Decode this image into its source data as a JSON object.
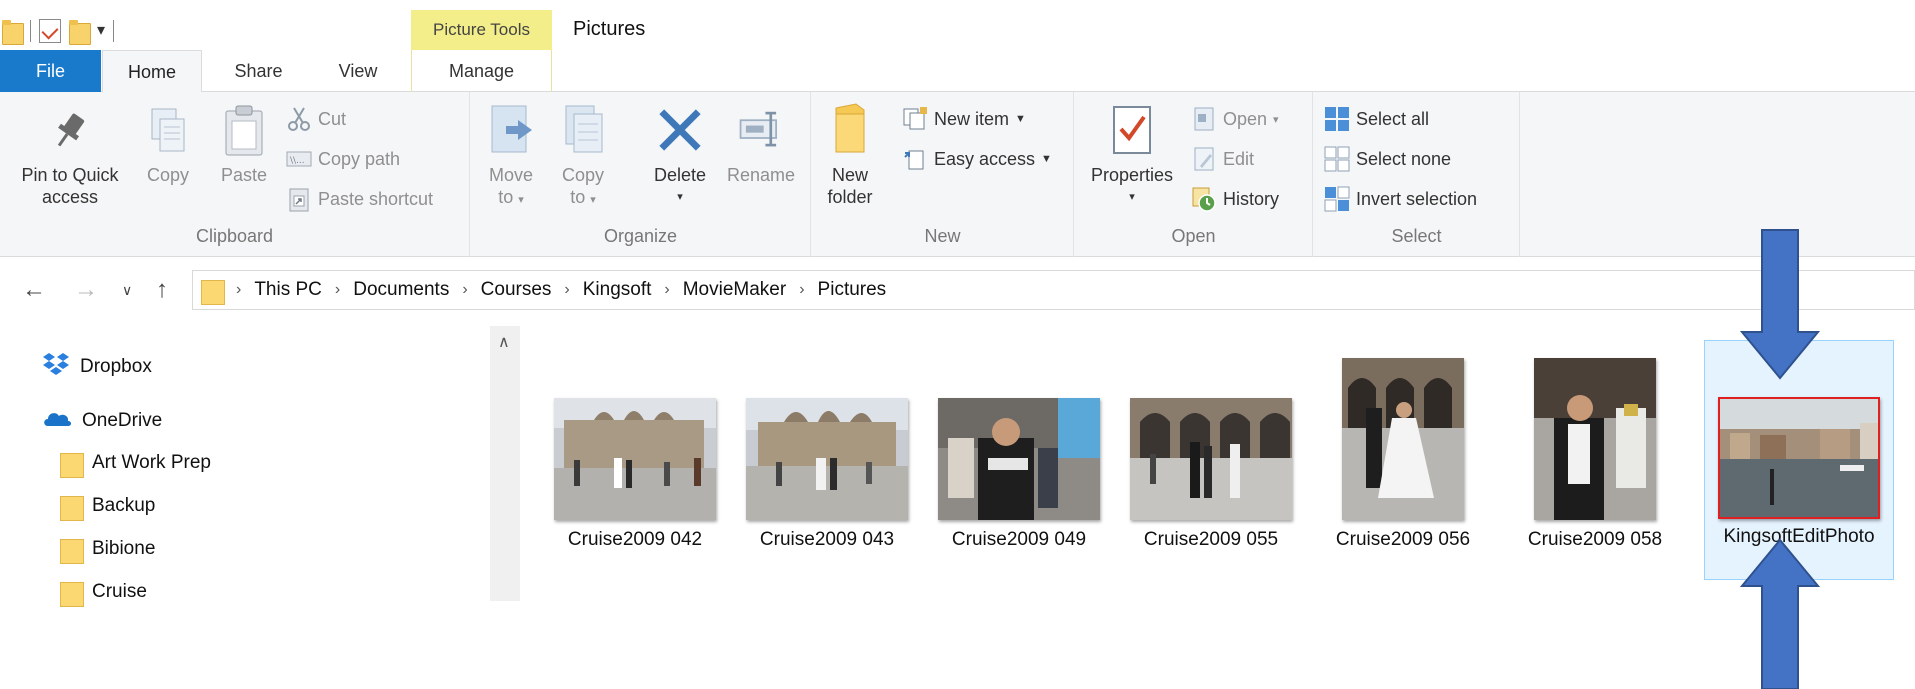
{
  "window": {
    "title": "Pictures",
    "contextual_tab_group": "Picture Tools"
  },
  "tabs": {
    "file": "File",
    "home": "Home",
    "share": "Share",
    "view": "View",
    "manage": "Manage"
  },
  "ribbon": {
    "clipboard": {
      "label": "Clipboard",
      "pin_line1": "Pin to Quick",
      "pin_line2": "access",
      "copy": "Copy",
      "paste": "Paste",
      "cut": "Cut",
      "copy_path": "Copy path",
      "paste_shortcut": "Paste shortcut"
    },
    "organize": {
      "label": "Organize",
      "move_line1": "Move",
      "move_line2": "to",
      "copy_line1": "Copy",
      "copy_line2": "to",
      "delete": "Delete",
      "rename": "Rename"
    },
    "new": {
      "label": "New",
      "new_folder_line1": "New",
      "new_folder_line2": "folder",
      "new_item": "New item",
      "easy_access": "Easy access"
    },
    "open": {
      "label": "Open",
      "properties": "Properties",
      "open": "Open",
      "edit": "Edit",
      "history": "History"
    },
    "select": {
      "label": "Select",
      "select_all": "Select all",
      "select_none": "Select none",
      "invert_selection": "Invert selection"
    }
  },
  "address": {
    "crumbs": [
      "This PC",
      "Documents",
      "Courses",
      "Kingsoft",
      "MovieMaker",
      "Pictures"
    ]
  },
  "navpane": {
    "items": [
      "Dropbox",
      "OneDrive",
      "Art Work Prep",
      "Backup",
      "Bibione",
      "Cruise"
    ]
  },
  "files": [
    {
      "name": "Cruise2009 042"
    },
    {
      "name": "Cruise2009 043"
    },
    {
      "name": "Cruise2009 049"
    },
    {
      "name": "Cruise2009 055"
    },
    {
      "name": "Cruise2009 056"
    },
    {
      "name": "Cruise2009 058"
    },
    {
      "name": "KingsoftEditPhoto",
      "selected": true
    }
  ],
  "colors": {
    "file_tab": "#1979ca",
    "picture_tools": "#f3ee8a",
    "annotation_arrow": "#4472c4",
    "selection_bg": "#e5f3ff",
    "selection_border": "#99d1ff",
    "thumb_highlight": "#e02020"
  }
}
